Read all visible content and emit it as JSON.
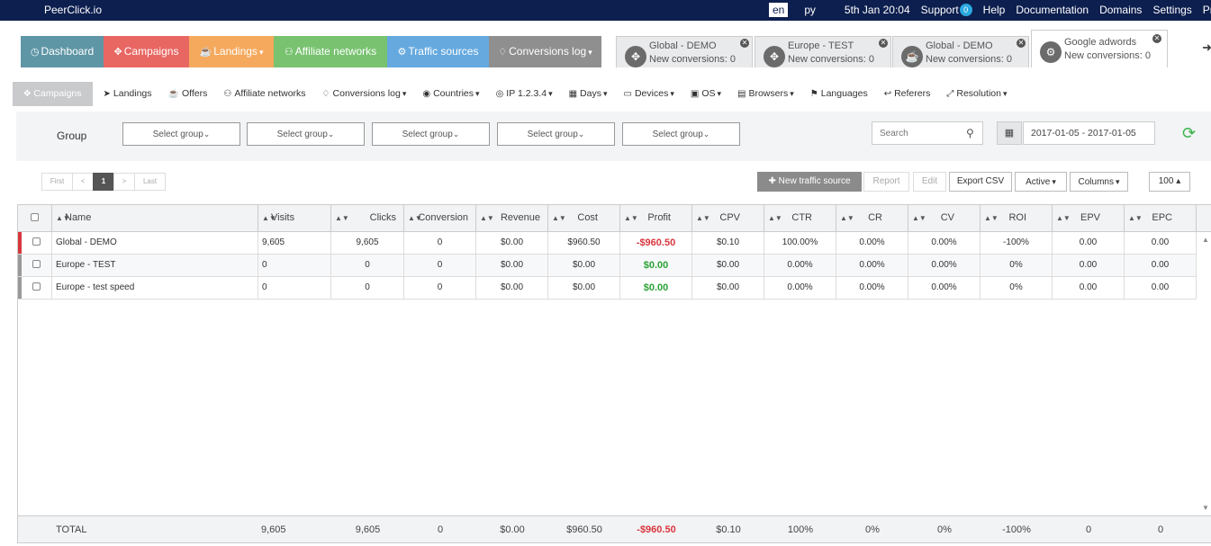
{
  "topbar": {
    "brand": "PeerClick.io",
    "lang_en": "en",
    "lang_ru": "ру",
    "datetime": "5th Jan 20:04",
    "support": "Support",
    "support_badge": "0",
    "help": "Help",
    "documentation": "Documentation",
    "domains": "Domains",
    "settings": "Settings",
    "profile": "Profile"
  },
  "mainnav": {
    "dashboard": "Dashboard",
    "campaigns": "Campaigns",
    "landings": "Landings",
    "affiliate_networks": "Affiliate networks",
    "traffic_sources": "Traffic sources",
    "conversions_log": "Conversions log"
  },
  "colors": {
    "dashboard": "#5f96a6",
    "campaigns": "#e86763",
    "landings": "#f5a95d",
    "affiliate_networks": "#78c270",
    "traffic_sources": "#65a9df",
    "conversions_log": "#8f8f8f",
    "topbar": "#0d1f4f",
    "loss": "#d9363e",
    "gain": "#2aa336"
  },
  "open_tabs": [
    {
      "title": "Global - DEMO",
      "subtitle": "New conversions: 0",
      "icon": "campaign-icon"
    },
    {
      "title": "Europe - TEST",
      "subtitle": "New conversions: 0",
      "icon": "campaign-icon"
    },
    {
      "title": "Global - DEMO",
      "subtitle": "New conversions: 0",
      "icon": "landing-icon"
    },
    {
      "title": "Google adwords",
      "subtitle": "New conversions: 0",
      "icon": "traffic-source-icon"
    }
  ],
  "subnav": {
    "campaigns": "Campaigns",
    "landings": "Landings",
    "offers": "Offers",
    "affiliate_networks": "Affiliate networks",
    "conversions_log": "Conversions log",
    "countries": "Countries",
    "ip": "IP 1.2.3.4",
    "days": "Days",
    "devices": "Devices",
    "os": "OS",
    "browsers": "Browsers",
    "languages": "Languages",
    "referers": "Referers",
    "resolution": "Resolution"
  },
  "groupbar": {
    "label": "Group",
    "select_placeholder": "Select group",
    "search_placeholder": "Search",
    "date_range": "2017-01-05 - 2017-01-05"
  },
  "pager": {
    "first": "First",
    "prev": "<",
    "current": "1",
    "next": ">",
    "last": "Last"
  },
  "actions": {
    "new_traffic_source": "New traffic source",
    "report": "Report",
    "edit": "Edit",
    "export_csv": "Export CSV",
    "active": "Active",
    "columns": "Columns",
    "page_size": "100"
  },
  "table": {
    "columns": [
      "Name",
      "Visits",
      "Clicks",
      "Conversion",
      "Revenue",
      "Cost",
      "Profit",
      "CPV",
      "CTR",
      "CR",
      "CV",
      "ROI",
      "EPV",
      "EPC"
    ],
    "rows": [
      {
        "name": "Global - DEMO",
        "visits": "9,605",
        "clicks": "9,605",
        "conversion": "0",
        "revenue": "$0.00",
        "cost": "$960.50",
        "profit": "-$960.50",
        "cpv": "$0.10",
        "ctr": "100.00%",
        "cr": "0.00%",
        "cv": "0.00%",
        "roi": "-100%",
        "epv": "0.00",
        "epc": "0.00"
      },
      {
        "name": "Europe - TEST",
        "visits": "0",
        "clicks": "0",
        "conversion": "0",
        "revenue": "$0.00",
        "cost": "$0.00",
        "profit": "$0.00",
        "cpv": "$0.00",
        "ctr": "0.00%",
        "cr": "0.00%",
        "cv": "0.00%",
        "roi": "0%",
        "epv": "0.00",
        "epc": "0.00"
      },
      {
        "name": "Europe - test speed",
        "visits": "0",
        "clicks": "0",
        "conversion": "0",
        "revenue": "$0.00",
        "cost": "$0.00",
        "profit": "$0.00",
        "cpv": "$0.00",
        "ctr": "0.00%",
        "cr": "0.00%",
        "cv": "0.00%",
        "roi": "0%",
        "epv": "0.00",
        "epc": "0.00"
      }
    ],
    "total": {
      "label": "TOTAL",
      "visits": "9,605",
      "clicks": "9,605",
      "conversion": "0",
      "revenue": "$0.00",
      "cost": "$960.50",
      "profit": "-$960.50",
      "cpv": "$0.10",
      "ctr": "100%",
      "cr": "0%",
      "cv": "0%",
      "roi": "-100%",
      "epv": "0",
      "epc": "0"
    }
  }
}
